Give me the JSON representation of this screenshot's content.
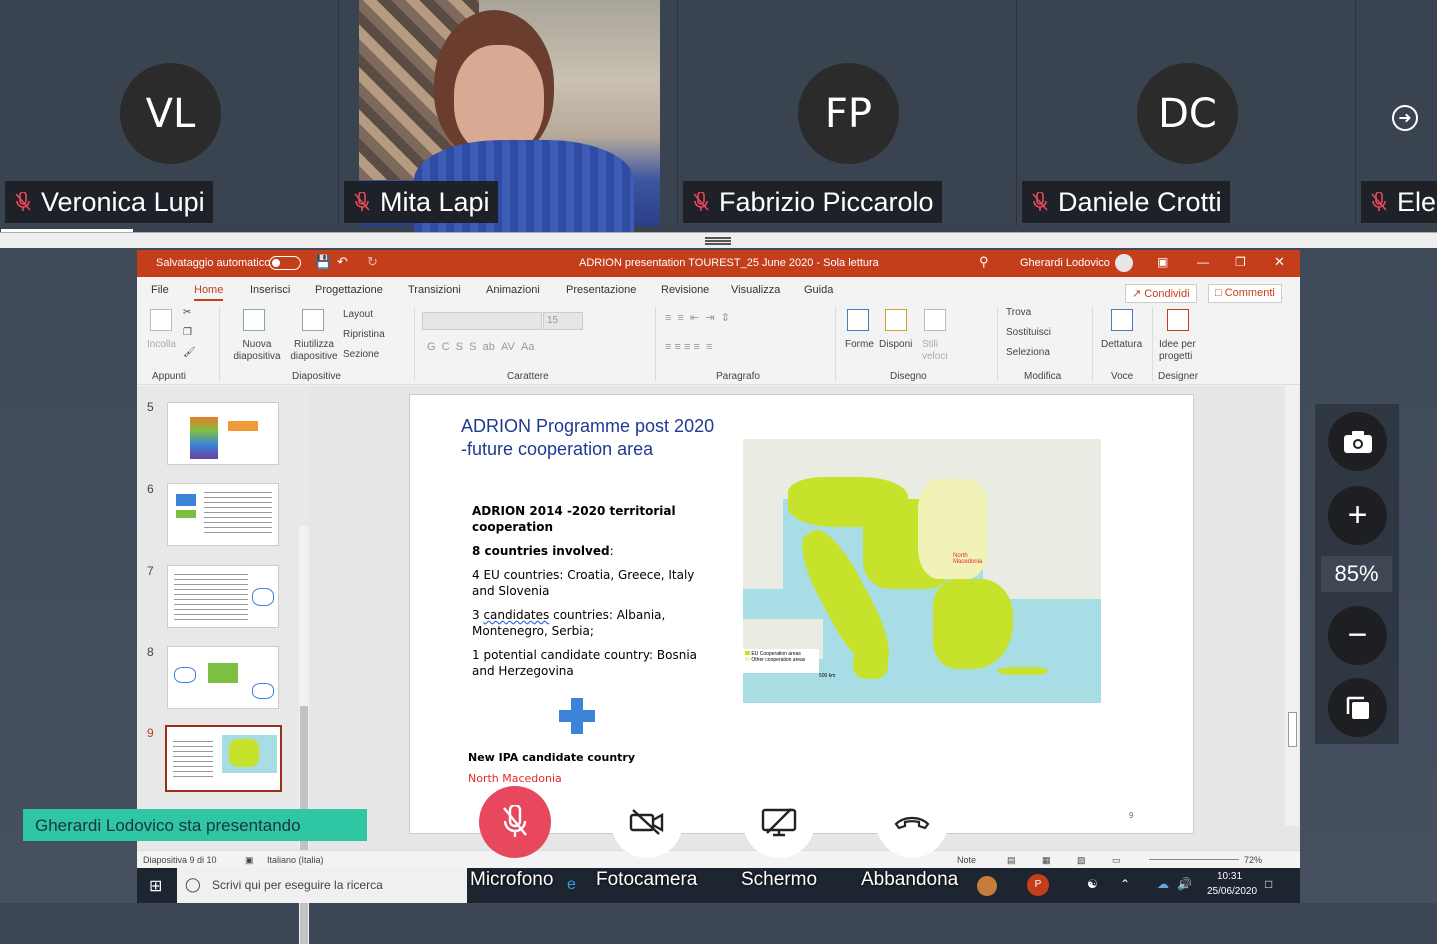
{
  "participants": [
    {
      "initials": "VL",
      "name": "Veronica Lupi",
      "muted": true
    },
    {
      "initials": "",
      "name": "Mita Lapi",
      "muted": true,
      "video": true
    },
    {
      "initials": "FP",
      "name": "Fabrizio Piccarolo",
      "muted": true
    },
    {
      "initials": "DC",
      "name": "Daniele Crotti",
      "muted": true
    },
    {
      "initials": "",
      "name": "Eler",
      "muted": true
    }
  ],
  "ppt": {
    "autosave_label": "Salvataggio automatico",
    "doc_title": "ADRION presentation TOUREST_25 June 2020  -  Sola lettura",
    "user": "Gherardi Lodovico",
    "tabs": [
      "File",
      "Home",
      "Inserisci",
      "Progettazione",
      "Transizioni",
      "Animazioni",
      "Presentazione",
      "Revisione",
      "Visualizza",
      "Guida"
    ],
    "active_tab": "Home",
    "share_label": "Condividi",
    "comments_label": "Commenti",
    "ribbon": {
      "incolla": "Incolla",
      "appunti": "Appunti",
      "nuova": "Nuova diapositiva",
      "riutilizza": "Riutilizza diapositive",
      "layout": "Layout",
      "ripristina": "Ripristina",
      "sezione": "Sezione",
      "diapositive": "Diapositive",
      "font_size": "15",
      "carattere": "Carattere",
      "paragrafo": "Paragrafo",
      "forme": "Forme",
      "disponi": "Disponi",
      "stili": "Stili veloci",
      "disegno": "Disegno",
      "trova": "Trova",
      "sostituisci": "Sostituisci",
      "seleziona": "Seleziona",
      "modifica": "Modifica",
      "dettatura": "Dettatura",
      "voce": "Voce",
      "idee": "Idee per progetti",
      "designer": "Designer"
    },
    "thumbs": [
      "5",
      "6",
      "7",
      "8",
      "9"
    ],
    "selected_thumb": "9",
    "slide": {
      "title_line1": "ADRION Programme post 2020",
      "title_line2": "-future cooperation area",
      "heading": "ADRION 2014 -2020 territorial cooperation",
      "countries": "8 countries involved",
      "eu": "4 EU countries: Croatia, Greece, Italy and Slovenia",
      "candidates_word": "candidates",
      "candidates_rest": " countries: Albania, Montenegro, Serbia;",
      "potential": "1 potential candidate country: Bosnia and Herzegovina",
      "new_ipa": "New IPA candidate country",
      "north_mac": "North Macedonia",
      "map_label": "North Macedonia",
      "legend1": "EU Cooperation areas",
      "legend2": "Other cooperation areas",
      "scale": "500 km",
      "page": "9"
    },
    "status": {
      "slide_of": "Diapositiva 9 di 10",
      "language": "Italiano (Italia)",
      "notes": "Note",
      "zoom": "72%"
    }
  },
  "taskbar": {
    "search_placeholder": "Scrivi qui per eseguire la ricerca",
    "time": "10:31",
    "date": "25/06/2020"
  },
  "controls": {
    "zoom": "85%"
  },
  "presenting_banner": "Gherardi Lodovico sta presentando",
  "call": {
    "mic": "Microfono",
    "camera": "Fotocamera",
    "screen": "Schermo",
    "leave": "Abbandona"
  },
  "colors": {
    "accent": "#c43e1c",
    "banner": "#2fc7a3",
    "mic_red": "#e8485e"
  }
}
